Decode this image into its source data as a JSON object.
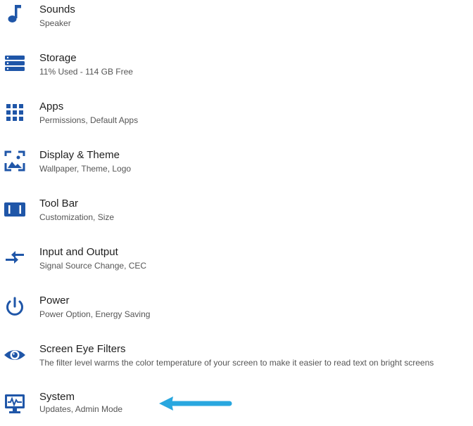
{
  "colors": {
    "icon": "#1f56a8",
    "title": "#1f1f1f",
    "subtitle": "#555555",
    "arrow": "#29a7df"
  },
  "settings": {
    "items": [
      {
        "icon": "music-note-icon",
        "title": "Sounds",
        "subtitle": "Speaker"
      },
      {
        "icon": "storage-icon",
        "title": "Storage",
        "subtitle": "11% Used - 114 GB Free"
      },
      {
        "icon": "apps-grid-icon",
        "title": "Apps",
        "subtitle": "Permissions, Default Apps"
      },
      {
        "icon": "image-frame-icon",
        "title": "Display & Theme",
        "subtitle": "Wallpaper, Theme, Logo"
      },
      {
        "icon": "toolbar-icon",
        "title": "Tool Bar",
        "subtitle": "Customization, Size"
      },
      {
        "icon": "input-output-arrows-icon",
        "title": "Input and Output",
        "subtitle": "Signal Source Change, CEC"
      },
      {
        "icon": "power-icon",
        "title": "Power",
        "subtitle": "Power Option, Energy Saving"
      },
      {
        "icon": "eye-icon",
        "title": "Screen Eye Filters",
        "subtitle": "The filter level warms the color temperature of your screen to make it easier to read text on bright screens"
      },
      {
        "icon": "system-monitor-icon",
        "title": "System",
        "subtitle": "Updates, Admin Mode"
      }
    ]
  },
  "annotation": {
    "icon": "left-arrow-icon"
  }
}
